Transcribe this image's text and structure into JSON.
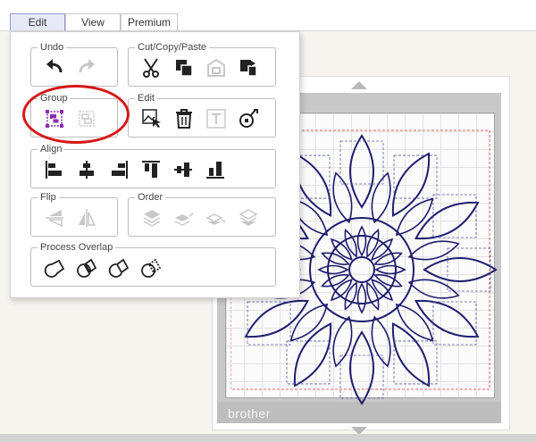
{
  "menu": {
    "tabs": [
      {
        "label": "Edit"
      },
      {
        "label": "View"
      },
      {
        "label": "Premium"
      }
    ]
  },
  "panel": {
    "groups": {
      "undo": {
        "label": "Undo"
      },
      "cut_copy_paste": {
        "label": "Cut/Copy/Paste"
      },
      "group": {
        "label": "Group"
      },
      "edit": {
        "label": "Edit"
      },
      "align": {
        "label": "Align"
      },
      "flip": {
        "label": "Flip"
      },
      "order": {
        "label": "Order"
      },
      "process_overlap": {
        "label": "Process Overlap"
      }
    }
  },
  "canvas": {
    "brand": "brother"
  },
  "colors": {
    "accent": "#8b2bb5",
    "highlight": "#d51818",
    "artwork": "#1f1d6e"
  }
}
